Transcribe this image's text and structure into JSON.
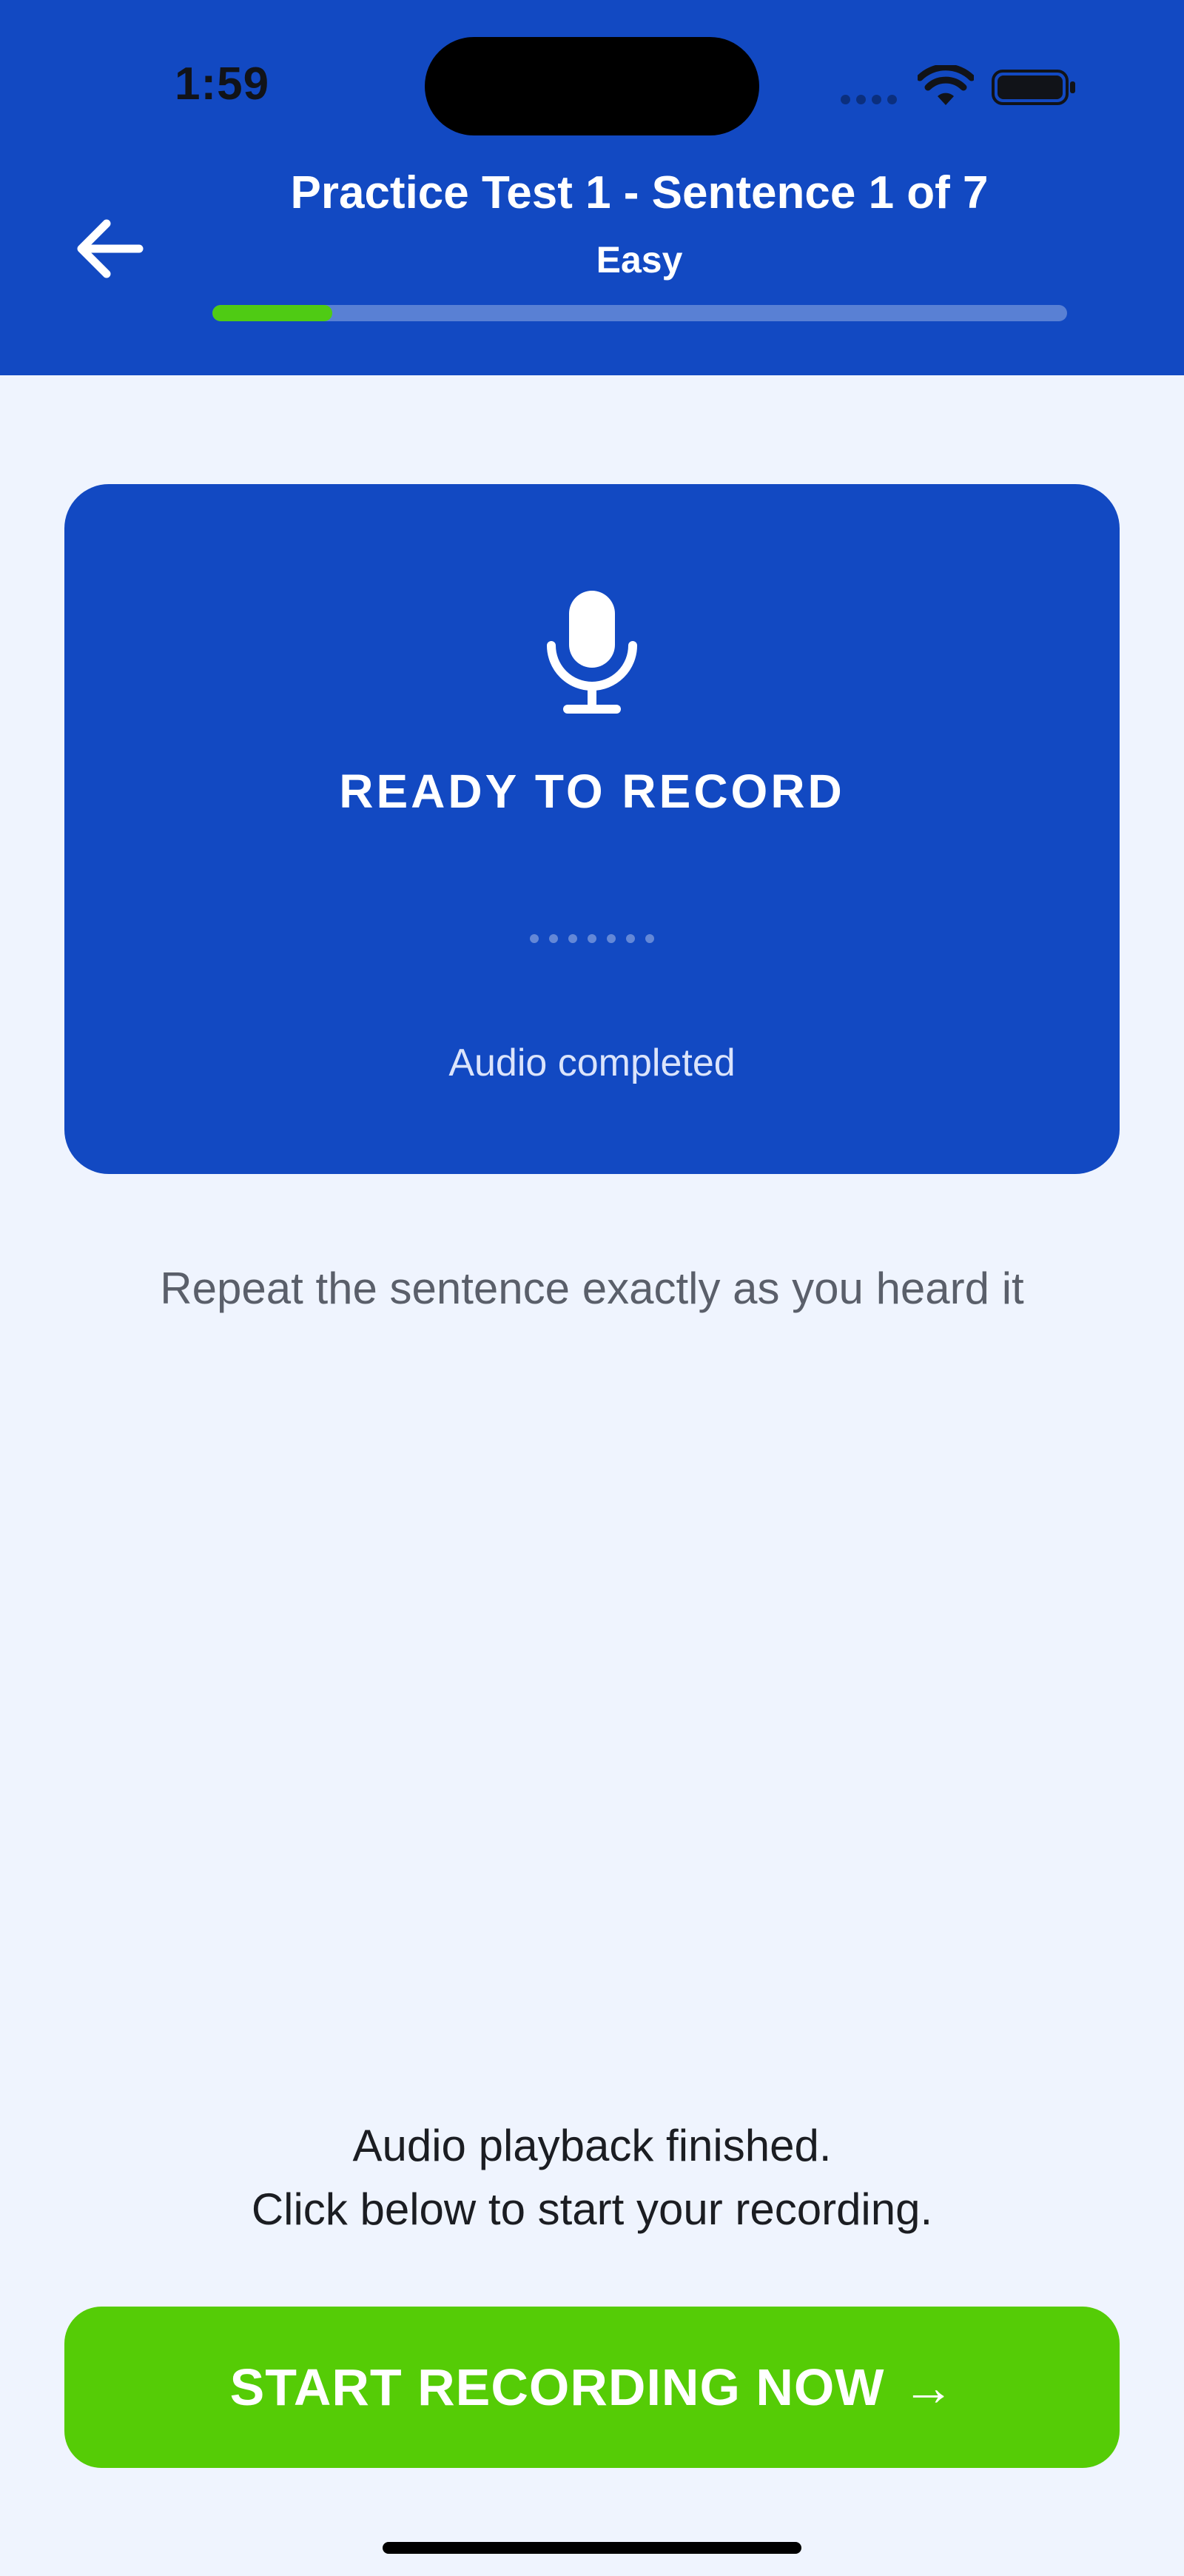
{
  "status_bar": {
    "time": "1:59",
    "wifi_icon": "wifi-icon",
    "battery_icon": "battery-icon"
  },
  "header": {
    "back_icon": "arrow-left-icon",
    "title": "Practice Test 1 - Sentence 1 of 7",
    "subtitle": "Easy",
    "progress_fraction": 0.14,
    "colors": {
      "background": "#1249c2",
      "progress_fill": "#4fcb14"
    }
  },
  "record_card": {
    "icon": "microphone-icon",
    "title": "READY TO RECORD",
    "status": "Audio completed",
    "waveform_dot_count": 7
  },
  "instruction": "Repeat the sentence exactly as you heard it",
  "info": {
    "line1": "Audio playback finished.",
    "line2": "Click below to start your recording."
  },
  "start_button": {
    "label": "START RECORDING NOW",
    "arrow": "→",
    "color": "#55cc06"
  }
}
